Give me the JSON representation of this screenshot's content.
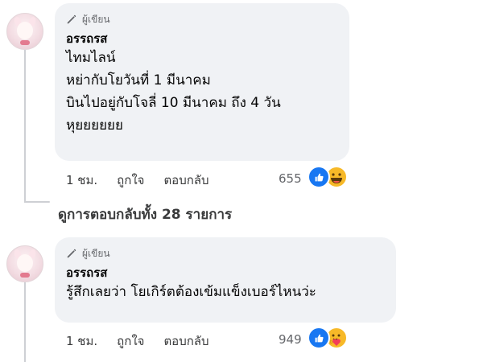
{
  "comments": [
    {
      "badge": "ผู้เขียน",
      "name": "อรรถรส",
      "lines": [
        "ไทมไลน์",
        "หย่ากับโยวันที่ 1 มีนาคม",
        "บินไปอยู่กับโจลี่ 10 มีนาคม ถึง 4 วัน",
        "หุยยยยยย"
      ],
      "time": "1 ชม.",
      "like": "ถูกใจ",
      "reply": "ตอบกลับ",
      "reaction_count": "655",
      "reactions": [
        "like-icon",
        "haha-icon"
      ]
    },
    {
      "badge": "ผู้เขียน",
      "name": "อรรถรส",
      "lines": [
        "รู้สึกเลยว่า โยเกิร์ตต้องเข้มแข็งเบอร์ไหนว่ะ"
      ],
      "time": "1 ชม.",
      "like": "ถูกใจ",
      "reply": "ตอบกลับ",
      "reaction_count": "949",
      "reactions": [
        "like-icon",
        "care-icon"
      ]
    }
  ],
  "view_replies": "ดูการตอบกลับทั้ง 28 รายการ",
  "colors": {
    "bubble": "#f0f2f5",
    "like": "#1877f2",
    "emoji": "#f7b928"
  }
}
